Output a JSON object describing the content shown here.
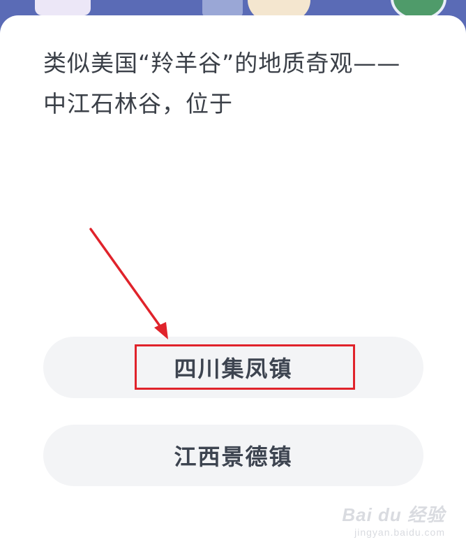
{
  "question": {
    "line1": "类似美国“羚羊谷”的地质奇观——",
    "line2": "中江石林谷，位于"
  },
  "options": [
    {
      "label": "四川集凤镇"
    },
    {
      "label": "江西景德镇"
    }
  ],
  "annotation": {
    "color": "#e0232b",
    "target": "options.0"
  },
  "watermark": {
    "brand": "Bai du 经验",
    "url": "jingyan.baidu.com"
  }
}
